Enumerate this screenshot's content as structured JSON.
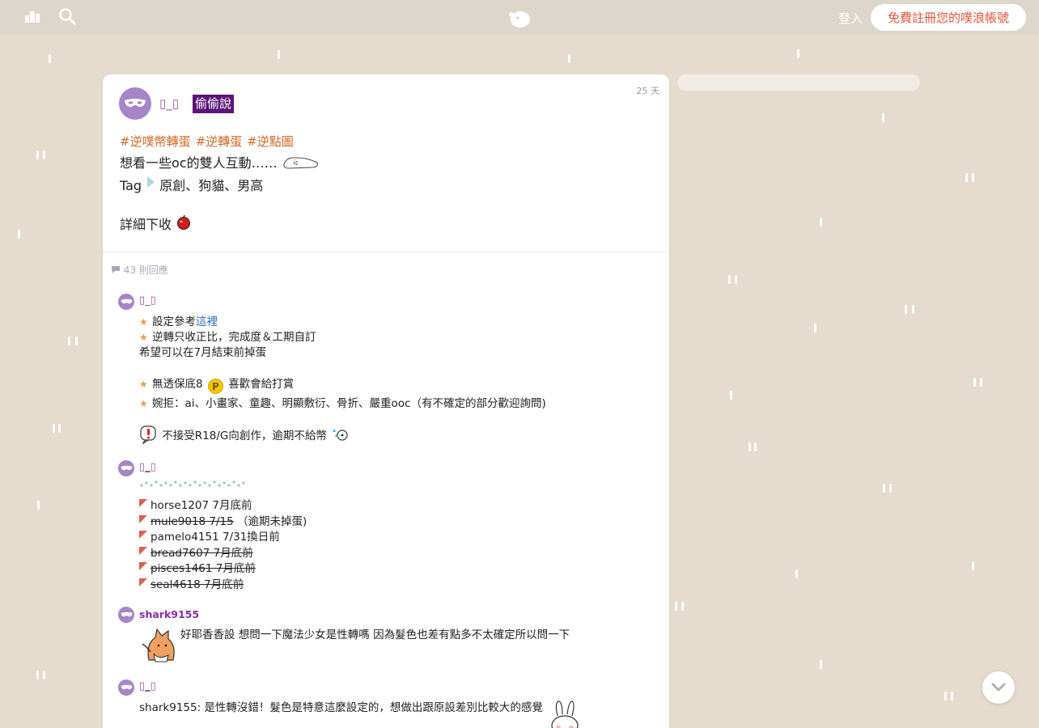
{
  "topbar": {
    "login_label": "登入",
    "signup_label": "免費註冊您的噗浪帳號"
  },
  "post": {
    "author": "▯_▯",
    "badge": "偷偷說",
    "time": "25 天",
    "tags": [
      "#逆噗幣轉蛋",
      "#逆轉蛋",
      "#逆點圖"
    ],
    "line1": "想看一些oc的雙人互動……",
    "line2_prefix": "Tag",
    "line2_text": "原創、狗貓、男高",
    "line3": "詳細下收",
    "replies_count": "43 則回應"
  },
  "replies": [
    {
      "author": "▯_▯",
      "lines": {
        "l1_prefix": "設定參考",
        "l1_link": "這裡",
        "l2": "逆轉只收正比，完成度＆工期自訂",
        "l3": "希望可以在7月結束前掉蛋",
        "l4_prefix": "無透保底8",
        "l4_coin": "P",
        "l4_suffix": "喜歡會給打賞",
        "l5": "婉拒：ai、小畫家、童趣、明顯敷衍、骨折、嚴重ooc（有不確定的部分歡迎詢問)",
        "l6": "不接受R18/G向創作，逾期不給幣"
      }
    },
    {
      "author": "▯_▯",
      "entries": [
        {
          "text": "horse1207 7月底前",
          "struck": "",
          "note": ""
        },
        {
          "text": "",
          "struck": "mule9018 7/15",
          "note": "（逾期未掉蛋)"
        },
        {
          "text": "pamelo4151 7/31換日前",
          "struck": "",
          "note": ""
        },
        {
          "text": "",
          "struck": "bread7607 7月底前",
          "note": ""
        },
        {
          "text": "",
          "struck": "pisces1461 7月底前",
          "note": ""
        },
        {
          "text": "",
          "struck": "seal4618 7月底前",
          "note": ""
        }
      ]
    },
    {
      "author": "shark9155",
      "text": "好耶香香設 想問一下魔法少女是性轉嗎 因為髮色也差有點多不太確定所以問一下"
    },
    {
      "author": "▯_▯",
      "text": "shark9155: 是性轉沒錯！髮色是特意這麼設定的，想做出跟原設差別比較大的感覺"
    }
  ],
  "colors": {
    "background": "#e5dbcf",
    "accent_orange": "#e4553a",
    "tag_color": "#cf6a28",
    "name_purple": "#9a52a0",
    "badge_purple": "#5b1577"
  }
}
